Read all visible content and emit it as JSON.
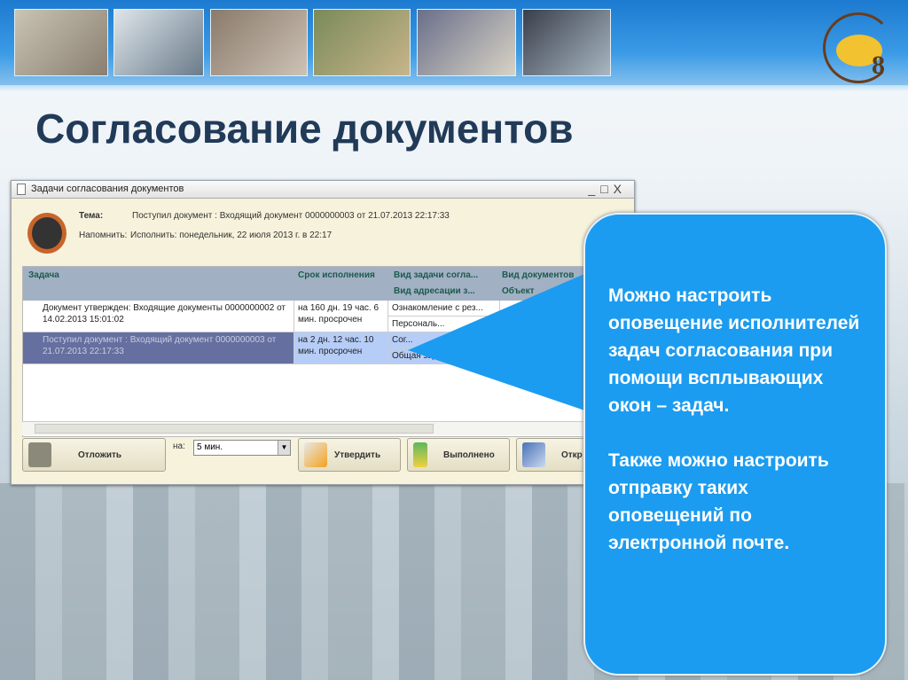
{
  "slide": {
    "title": "Согласование документов"
  },
  "window": {
    "title": "Задачи согласования документов",
    "controls": [
      "_",
      "□",
      "X"
    ],
    "subject_label": "Тема:",
    "subject_value": "Поступил документ : Входящий документ 0000000003 от 21.07.2013 22:17:33",
    "remind_label": "Напомнить:",
    "remind_value": "Исполнить: понедельник, 22 июля 2013 г. в 22:17",
    "columns": {
      "task": "Задача",
      "deadline": "Срок исполнения",
      "task_type": "Вид задачи согла...",
      "addr_type": "Вид адресации з...",
      "doc_type": "Вид документов",
      "object": "Объект"
    },
    "rows": [
      {
        "task": "Документ утвержден: Входящие документы 0000000002 от 14.02.2013 15:01:02",
        "deadline": "на 160 дн. 19 час. 6 мин. просрочен",
        "task_type": "Ознакомление с рез...",
        "addr_type": "Персональ..."
      },
      {
        "task": "Поступил документ : Входящий документ 0000000003 от 21.07.2013 22:17:33",
        "deadline": "на 2 дн. 12 час. 10 мин. просрочен",
        "task_type": "Сог...",
        "addr_type": "Общая задача"
      }
    ],
    "postpone_label": "Отложить",
    "for_label": "на:",
    "postpone_value": "5 мин.",
    "approve_label": "Утвердить",
    "done_label": "Выполнено",
    "open_label": "Откр"
  },
  "callout": {
    "p1": "Можно настроить оповещение исполнителей задач согласования при помощи всплывающих окон – задач.",
    "p2": "Также можно настроить отправку таких оповещений по электронной почте."
  },
  "colors": {
    "callout": "#1b9cf0",
    "title": "#213a57",
    "selected_row": "#6570a0"
  }
}
